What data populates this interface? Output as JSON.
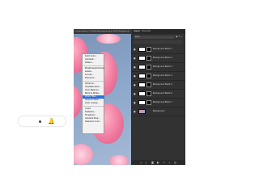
{
  "window": {
    "document_title": "1_cassie-bodeva-7_Ch0mJYnFA-unsplash.jpg @ 16.8% (Background)"
  },
  "layers_panel": {
    "tabs": [
      "Layers",
      "Channels"
    ],
    "filter_kind": "Kind",
    "layers": [
      {
        "name": "Background Black 1",
        "thumb": "white"
      },
      {
        "name": "Background Black 2",
        "thumb": "white"
      },
      {
        "name": "Background Black 3",
        "thumb": "white"
      },
      {
        "name": "Background Black 4",
        "thumb": "white"
      },
      {
        "name": "Background Black 5",
        "thumb": "white"
      },
      {
        "name": "Background Black 6",
        "thumb": "white"
      },
      {
        "name": "Background Black 7",
        "thumb": "white"
      },
      {
        "name": "Background",
        "thumb": "photo"
      }
    ],
    "bottom_icons": [
      "link-icon",
      "fx-icon",
      "mask-icon",
      "adjustment-icon",
      "folder-icon",
      "new-layer-icon",
      "trash-icon"
    ]
  },
  "adjustment_menu": {
    "items": [
      "Solid Color...",
      "Gradient...",
      "Pattern...",
      "---",
      "Brightness/Contrast...",
      "Levels...",
      "Curves...",
      "Exposure...",
      "---",
      "Vibrance...",
      "Hue/Saturation...",
      "Color Balance...",
      "Black & White...",
      "Photo Filter...",
      "Channel Mixer...",
      "Color Lookup...",
      "---",
      "Invert",
      "Posterize...",
      "Threshold...",
      "Gradient Map...",
      "Selective Color..."
    ],
    "selected": "Photo Filter..."
  },
  "overlay_bar": {
    "icon": "bell-icon"
  },
  "colors": {
    "panel_bg": "#323232",
    "menu_highlight": "#2f6fd8",
    "macaron_pink": "#f07aa0",
    "canvas_blue": "#8aa6c9"
  }
}
